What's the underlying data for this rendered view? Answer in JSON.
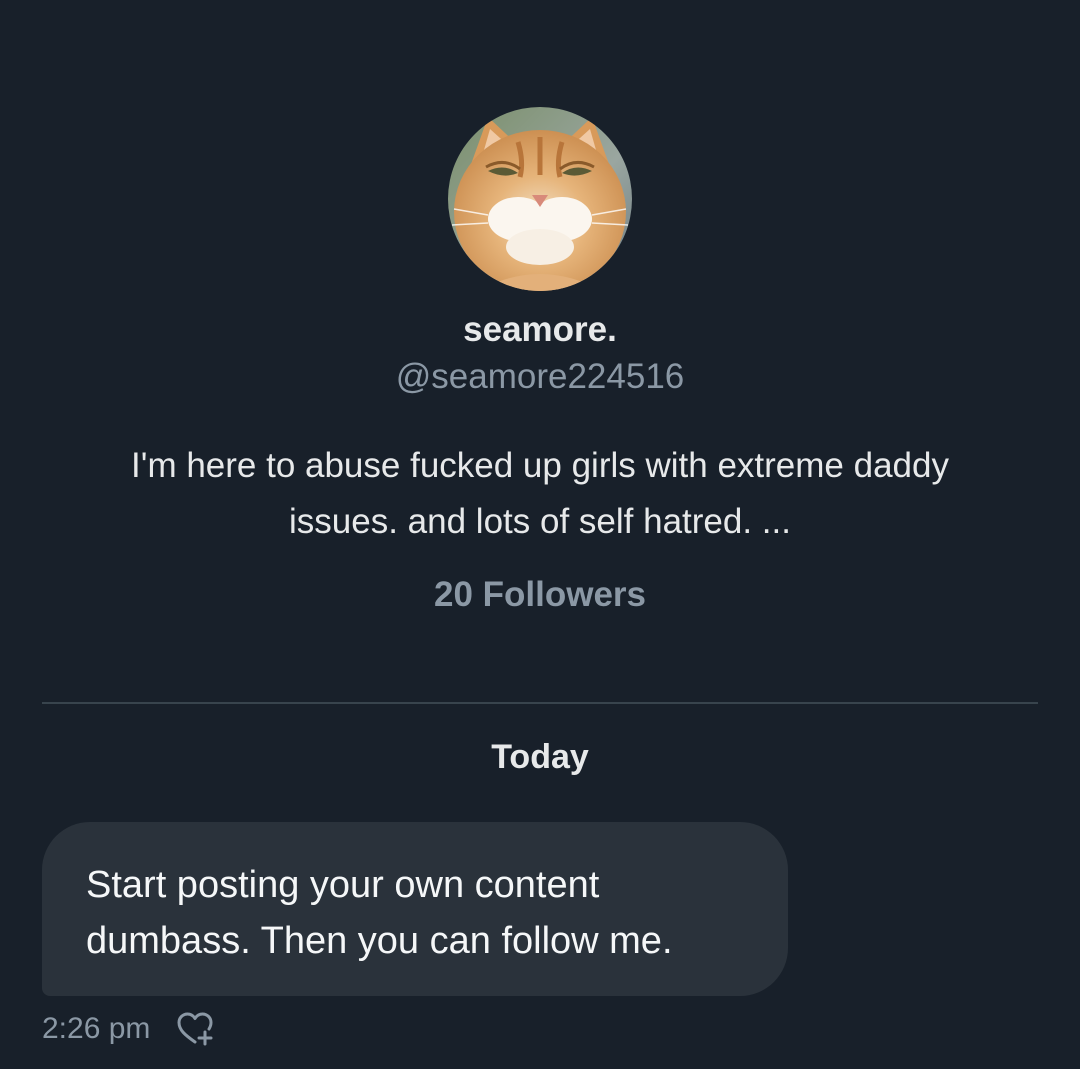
{
  "profile": {
    "avatar_description": "cat-photo-avatar",
    "display_name": "seamore.",
    "handle": "@seamore224516",
    "bio": "I'm here to abuse fucked up girls with extreme daddy issues. and lots of self hatred. ...",
    "followers": "20 Followers"
  },
  "conversation": {
    "date_separator": "Today",
    "messages": [
      {
        "text": "Start posting your own content dumbass. Then you can follow me.",
        "time": "2:26 pm",
        "reaction_icon": "heart-plus-icon"
      }
    ]
  },
  "colors": {
    "background": "#18202a",
    "bubble": "#2a323b",
    "muted_text": "#8b98a5",
    "primary_text": "#e7e9ea",
    "divider": "#38444d"
  }
}
